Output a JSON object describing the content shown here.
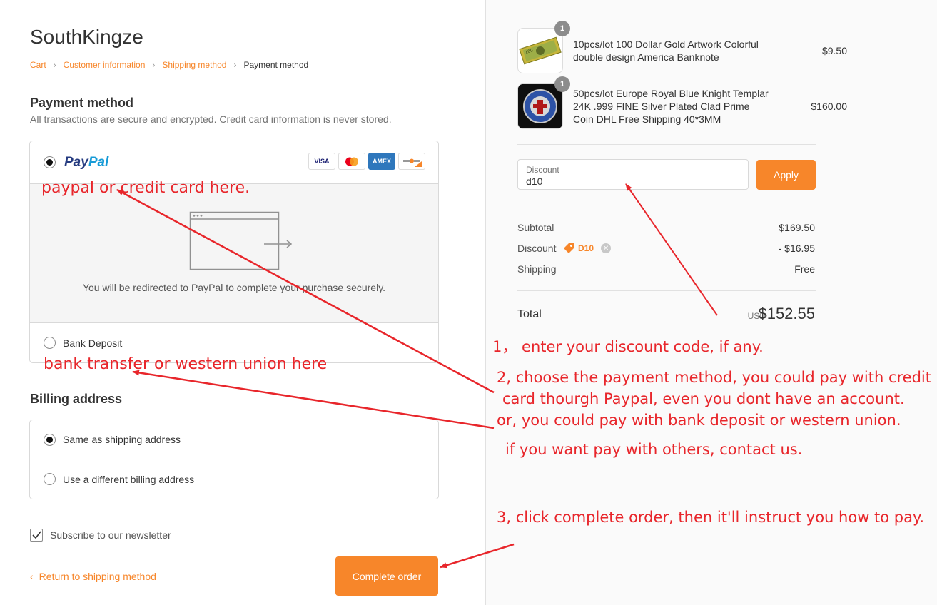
{
  "store": {
    "title": "SouthKingze"
  },
  "breadcrumb": [
    {
      "label": "Cart",
      "current": false
    },
    {
      "label": "Customer information",
      "current": false
    },
    {
      "label": "Shipping method",
      "current": false
    },
    {
      "label": "Payment method",
      "current": true
    }
  ],
  "payment": {
    "title": "Payment method",
    "subtitle": "All transactions are secure and encrypted. Credit card information is never stored.",
    "paypal": {
      "logo_part1": "Pay",
      "logo_part2": "Pal",
      "selected": true
    },
    "cards": [
      "VISA",
      "",
      "AMEX",
      ""
    ],
    "redirect_text": "You will be redirected to PayPal to complete your purchase securely.",
    "bank": {
      "label": "Bank Deposit",
      "selected": false
    }
  },
  "billing": {
    "title": "Billing address",
    "options": [
      {
        "label": "Same as shipping address",
        "selected": true
      },
      {
        "label": "Use a different billing address",
        "selected": false
      }
    ]
  },
  "newsletter": {
    "label": "Subscribe to our newsletter",
    "checked": true
  },
  "actions": {
    "return_label": "Return to shipping method",
    "complete_label": "Complete order"
  },
  "order": {
    "items": [
      {
        "quantity": "1",
        "name": "10pcs/lot 100 Dollar Gold Artwork Colorful double design America Banknote",
        "price": "$9.50"
      },
      {
        "quantity": "1",
        "name": "50pcs/lot Europe Royal Blue Knight Templar 24K .999 FINE Silver Plated Clad Prime Coin DHL Free Shipping 40*3MM",
        "price": "$160.00"
      }
    ],
    "discount_field": {
      "label": "Discount",
      "value": "d10"
    },
    "apply_label": "Apply",
    "subtotal_label": "Subtotal",
    "subtotal_value": "$169.50",
    "discount_label": "Discount",
    "discount_code": "D10",
    "discount_value": "- $16.95",
    "shipping_label": "Shipping",
    "shipping_value": "Free",
    "total_label": "Total",
    "currency": "USD",
    "total_value": "$152.55"
  },
  "annotations": {
    "paypal_note": "paypal or credit card here.",
    "bank_note": "bank transfer or western union here",
    "step1": "1， enter your discount code, if any.",
    "step2_line1": "2, choose the payment method, you could pay with credit",
    "step2_line2": "card thourgh Paypal, even you dont have an account.",
    "step2_line3": "or, you could pay with bank deposit or western union.",
    "step2_line4": "if you want pay with others, contact us.",
    "step3": "3, click complete order, then it'll instruct you how to pay.",
    "color": "#e8262b"
  },
  "colors": {
    "accent": "#f7862a",
    "paypal_dark": "#253b80",
    "paypal_light": "#179bd7"
  }
}
